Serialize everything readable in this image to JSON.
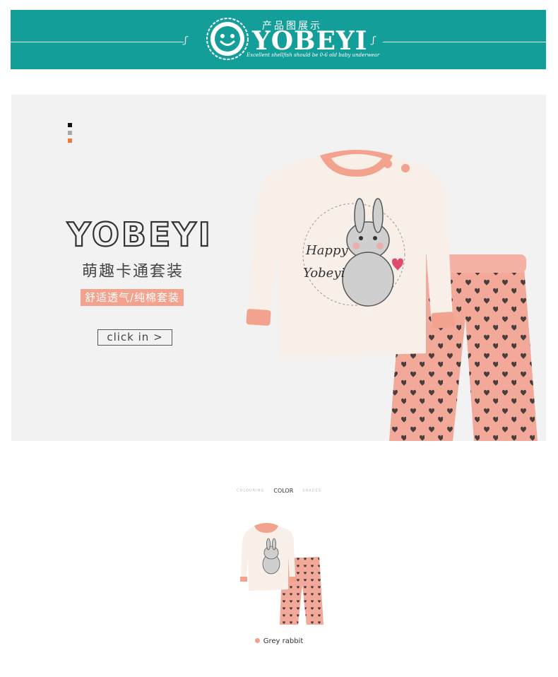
{
  "header": {
    "title_cn": "产品图展示",
    "brand": "YOBEYI",
    "tagline": "Excellent shellfish should be 0-6 old baby underwear",
    "background_color": "#149e99"
  },
  "hero": {
    "indicator_colors": [
      "#111111",
      "#aaaaaa",
      "#f0783c"
    ],
    "brand": "YOBEYI",
    "subtitle": "萌趣卡通套装",
    "tag": "舒适透气/纯棉套装",
    "button": "click in >",
    "shirt_text_1": "Happy",
    "shirt_text_2": "Yobeyi",
    "accent_color": "#f2a28d"
  },
  "color_section": {
    "prefix": "COLOURING",
    "title": "COLOR",
    "suffix": "SHADES",
    "items": [
      {
        "label": "Grey rabbit",
        "dot_color": "#f2a28d"
      }
    ]
  }
}
